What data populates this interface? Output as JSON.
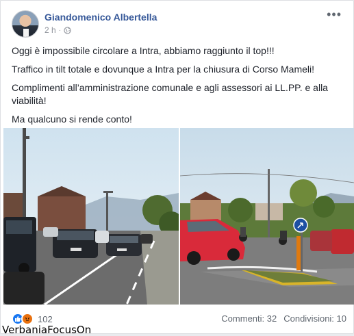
{
  "post": {
    "author": "Giandomenico Albertella",
    "time": "2 h",
    "separator": "·",
    "more_icon": "more-horizontal-icon",
    "privacy_icon": "globe-icon",
    "paragraphs": [
      "Oggi è impossibile circolare a Intra, abbiamo raggiunto il top!!!",
      "Traffico in tilt totale e dovunque a Intra per la chiusura di Corso Mameli!",
      "Complimenti all’amministrazione comunale e agli assessori ai LL.PP. e alla viabilità!",
      "Ma qualcuno si rende conto!"
    ]
  },
  "footer": {
    "reaction_count": "102",
    "comments": "Commenti: 32",
    "shares": "Condivisioni: 10"
  },
  "watermark": "VerbaniaFocusOn",
  "colors": {
    "link": "#365899",
    "like": "#1877f2",
    "angry": "#e9710f"
  }
}
